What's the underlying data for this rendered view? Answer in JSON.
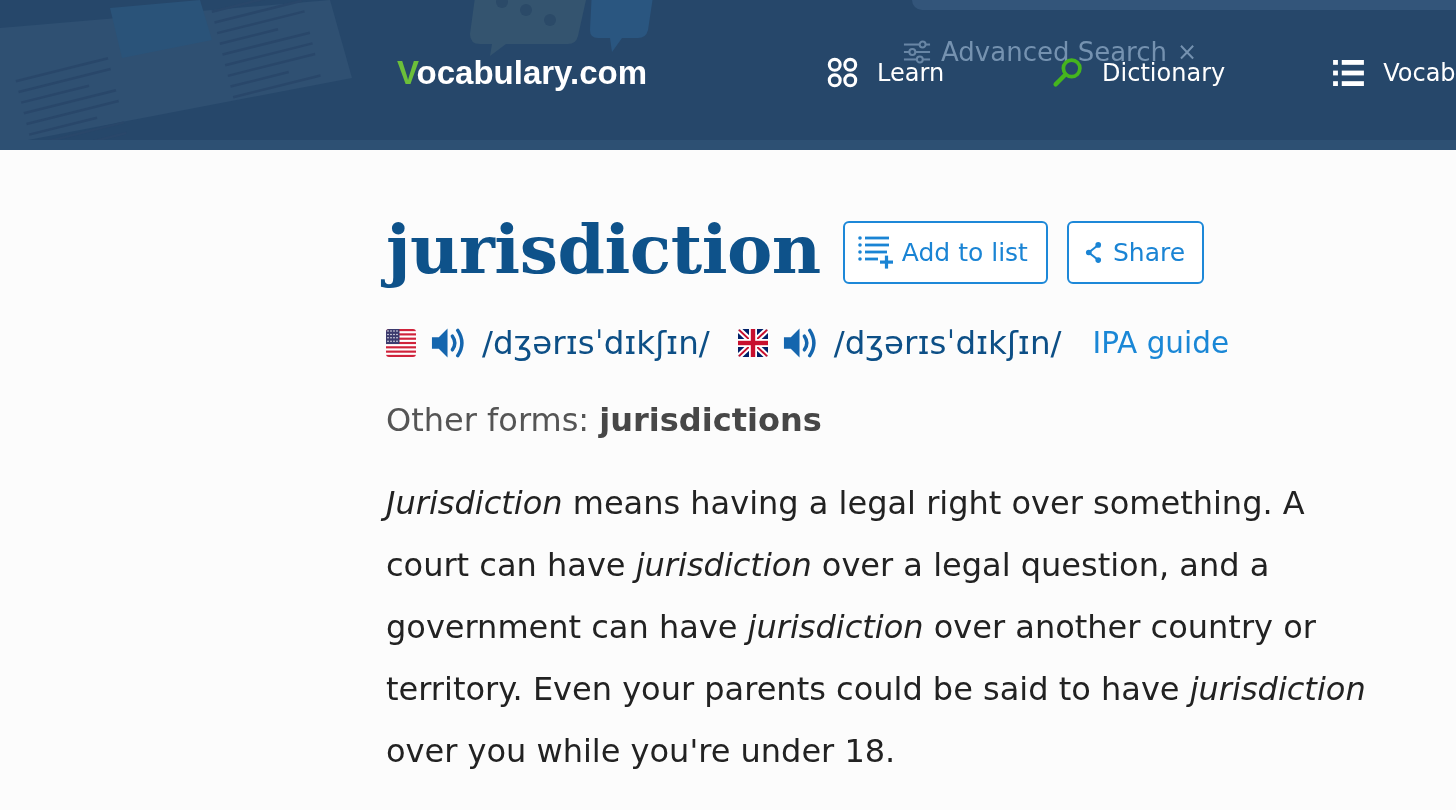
{
  "header": {
    "logo": "Vocabulary.com",
    "advanced_search": {
      "label": "Advanced Search",
      "close": "×"
    },
    "nav": [
      {
        "kind": "circles",
        "label": "Learn",
        "selected": false
      },
      {
        "kind": "search",
        "label": "Dictionary",
        "selected": true
      },
      {
        "kind": "list",
        "label": "Vocab",
        "selected": false
      }
    ]
  },
  "entry": {
    "word": "jurisdiction",
    "actions": [
      {
        "kind": "add",
        "label": "Add to list"
      },
      {
        "kind": "share",
        "label": "Share"
      }
    ],
    "pronunciations": [
      {
        "kind": "us",
        "ipa": "/dʒərɪsˈdɪkʃɪn/"
      },
      {
        "kind": "uk",
        "ipa": "/dʒərɪsˈdɪkʃɪn/"
      }
    ],
    "ipa_guide": "IPA guide",
    "other_forms": "Other forms: **jurisdictions**",
    "definition": "*Jurisdiction* means having a legal right over something. A court can have *jurisdiction* over a legal question, and a government can have *jurisdiction* over another country or territory. Even your parents could be said to have *jurisdiction* over you while you're under 18."
  }
}
